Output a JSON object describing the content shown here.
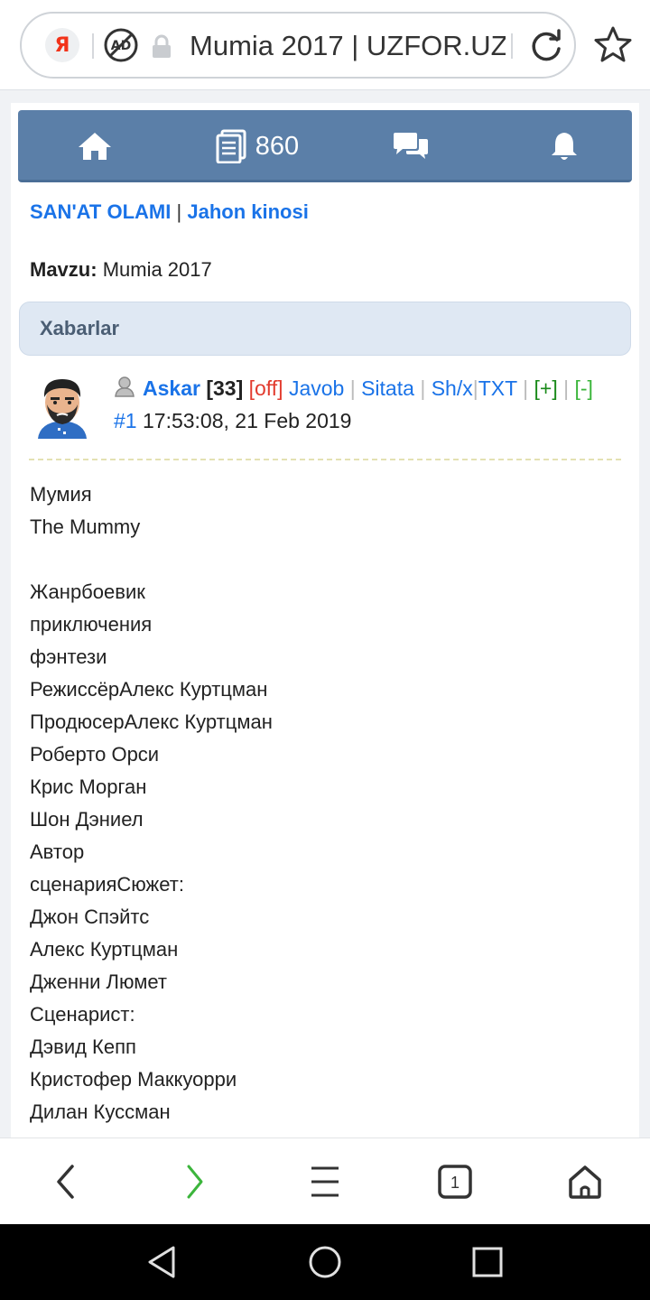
{
  "browser": {
    "url_text": "Mumia 2017 | UZFOR.UZ",
    "search_engine_glyph": "Я",
    "icons": [
      "yandex-icon",
      "adblock-icon",
      "lock-icon",
      "reload-icon",
      "bookmark-star-icon"
    ]
  },
  "topnav": {
    "posts_count": "860",
    "icons": [
      "home-icon",
      "posts-icon",
      "chat-icon",
      "bell-icon"
    ]
  },
  "breadcrumb": {
    "section": "SAN'AT OLAMI",
    "separator": "|",
    "subsection": "Jahon kinosi"
  },
  "topic": {
    "label": "Mavzu:",
    "title": "Mumia 2017"
  },
  "section_header": "Xabarlar",
  "post": {
    "username": "Askar",
    "rank": "[33]",
    "status": "[off]",
    "actions": {
      "reply": "Javob",
      "quote": "Sitata",
      "pm": "Sh/x",
      "txt": "TXT",
      "plus": "[+]",
      "minus": "[-]"
    },
    "number": "#1",
    "datetime": "17:53:08, 21 Feb 2019",
    "body_lines": [
      "Мумия",
      "The Mummy",
      "",
      "Жанрбоевик",
      "приключения",
      "фэнтези",
      "РежиссёрАлекс Куртцман",
      "ПродюсерАлекс Куртцман",
      "Роберто Орси",
      "Крис Морган",
      "Шон Дэниел",
      "Автор",
      "сценарияСюжет:",
      "Джон Спэйтс",
      "Алекс Куртцман",
      "Дженни Люмет",
      "Сценарист:",
      "Дэвид Кепп",
      "Кристофер Маккуорри",
      "Дилан Куссман"
    ]
  },
  "bottom_bar": {
    "tab_count": "1",
    "icons": [
      "back-icon",
      "forward-icon",
      "menu-icon",
      "tabs-icon",
      "home-icon"
    ]
  },
  "colors": {
    "nav_blue": "#5b7fa8",
    "link_blue": "#1a73e8",
    "off_red": "#e23b2e",
    "plus_green": "#1a8a1a"
  }
}
